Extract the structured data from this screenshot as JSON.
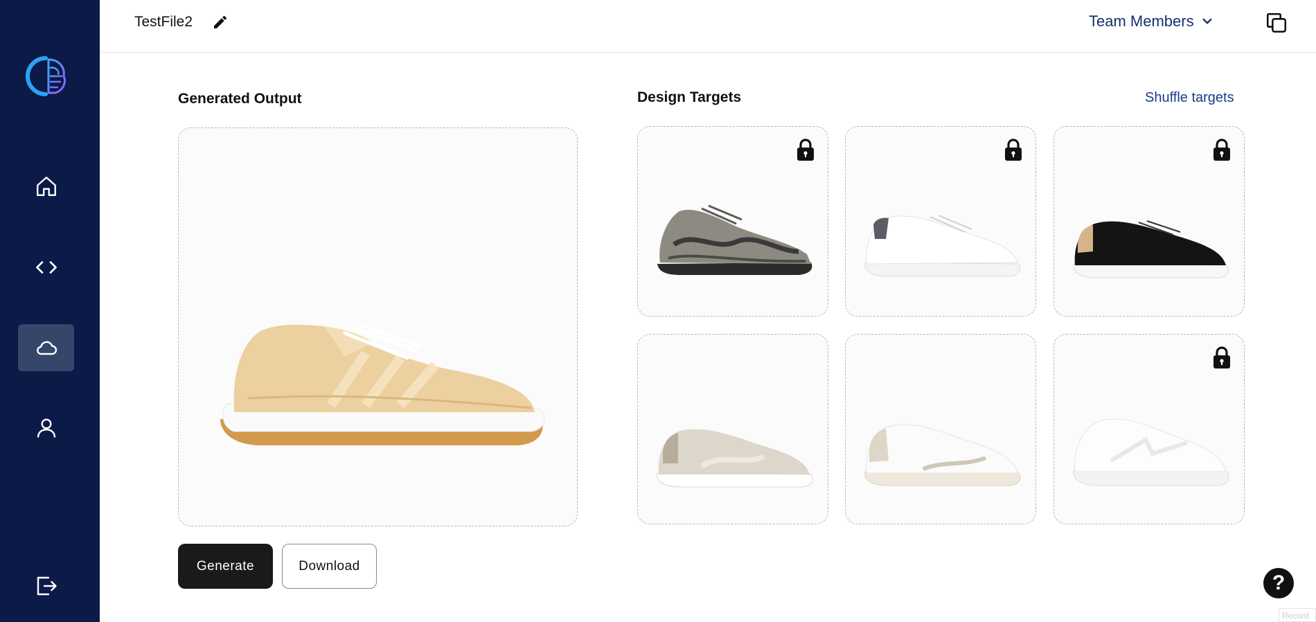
{
  "header": {
    "file_name": "TestFile2",
    "team_label": "Team Members"
  },
  "sidebar": {
    "items": [
      {
        "name": "home",
        "icon": "home-icon",
        "active": false
      },
      {
        "name": "code",
        "icon": "code-icon",
        "active": false
      },
      {
        "name": "cloud",
        "icon": "cloud-icon",
        "active": true
      },
      {
        "name": "profile",
        "icon": "user-icon",
        "active": false
      },
      {
        "name": "logout",
        "icon": "logout-icon",
        "active": false
      }
    ]
  },
  "output": {
    "title": "Generated Output",
    "shoe": "beige-knit-sneaker"
  },
  "targets": {
    "title": "Design Targets",
    "shuffle_label": "Shuffle targets",
    "items": [
      {
        "shoe": "grey-chunky-runner",
        "locked": true
      },
      {
        "shoe": "white-leather-sneaker",
        "locked": true
      },
      {
        "shoe": "black-leather-sneaker",
        "locked": true
      },
      {
        "shoe": "beige-suede-sneaker",
        "locked": false
      },
      {
        "shoe": "white-glitter-sneaker",
        "locked": false
      },
      {
        "shoe": "white-court-sneaker",
        "locked": true
      }
    ]
  },
  "actions": {
    "generate_label": "Generate",
    "download_label": "Download"
  },
  "help": {
    "label": "?",
    "record_label": "Record"
  },
  "colors": {
    "sidebar_bg": "#0b1a47",
    "active_nav": "#36456a",
    "link": "#1b3b8f",
    "primary_button": "#1a1a1a"
  }
}
